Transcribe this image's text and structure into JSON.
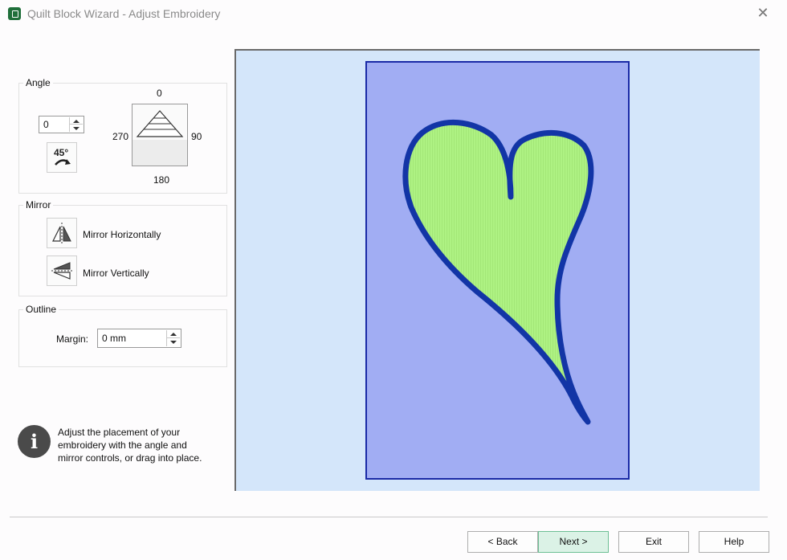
{
  "window": {
    "title": "Quilt Block Wizard - Adjust Embroidery",
    "close_label": "✕"
  },
  "angle": {
    "group_label": "Angle",
    "value": "0",
    "rotate_button_label": "45°",
    "dial": {
      "top": "0",
      "right": "90",
      "bottom": "180",
      "left": "270"
    }
  },
  "mirror": {
    "group_label": "Mirror",
    "horizontal_label": "Mirror Horizontally",
    "vertical_label": "Mirror Vertically"
  },
  "outline": {
    "group_label": "Outline",
    "margin_label": "Margin:",
    "margin_value": "0 mm"
  },
  "info": {
    "icon_glyph": "i",
    "lines": [
      "Adjust the placement of your",
      "embroidery with the angle and",
      "mirror controls, or drag into place."
    ]
  },
  "footer": {
    "back": "< Back",
    "next": "Next >",
    "exit": "Exit",
    "help": "Help"
  },
  "colors": {
    "canvas_bg": "#d4e6fa",
    "block_fill": "#a1adf3",
    "block_border": "#1a2aa6",
    "heart_fill": "#aef283",
    "heart_outline": "#1235a6",
    "primary_button_bg": "#dbf2e6"
  },
  "icons": {
    "app": "quilt-app-icon",
    "rotate": "rotate-45-icon",
    "dial": "angle-dial-icon",
    "mirror_h": "mirror-horizontal-icon",
    "mirror_v": "mirror-vertical-icon",
    "info": "info-icon"
  }
}
